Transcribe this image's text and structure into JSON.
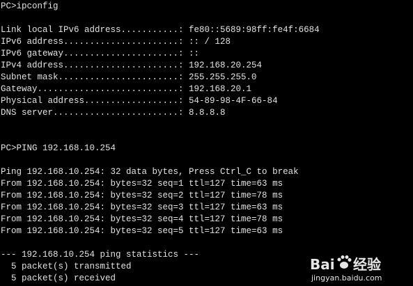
{
  "terminal": {
    "lines": [
      "PC>ipconfig",
      "",
      "Link local IPv6 address...........: fe80::5689:98ff:fe4f:6684",
      "IPv6 address......................: :: / 128",
      "IPv6 gateway......................: ::",
      "IPv4 address......................: 192.168.20.254",
      "Subnet mask.......................: 255.255.255.0",
      "Gateway...........................: 192.168.20.1",
      "Physical address..................: 54-89-98-4F-66-84",
      "DNS server........................: 8.8.8.8",
      "",
      "",
      "PC>PING 192.168.10.254",
      "",
      "Ping 192.168.10.254: 32 data bytes, Press Ctrl_C to break",
      "From 192.168.10.254: bytes=32 seq=1 ttl=127 time=63 ms",
      "From 192.168.10.254: bytes=32 seq=2 ttl=127 time=78 ms",
      "From 192.168.10.254: bytes=32 seq=3 ttl=127 time=63 ms",
      "From 192.168.10.254: bytes=32 seq=4 ttl=127 time=78 ms",
      "From 192.168.10.254: bytes=32 seq=5 ttl=127 time=63 ms",
      "",
      "--- 192.168.10.254 ping statistics ---",
      "  5 packet(s) transmitted",
      "  5 packet(s) received"
    ]
  },
  "watermark": {
    "brand_left": "Bai",
    "brand_right": "经验",
    "url": "jingyan.baidu.com",
    "icon": "paw-icon"
  },
  "colors": {
    "background": "#000000",
    "text": "#e2e2e2",
    "watermark": "#ffffff"
  }
}
